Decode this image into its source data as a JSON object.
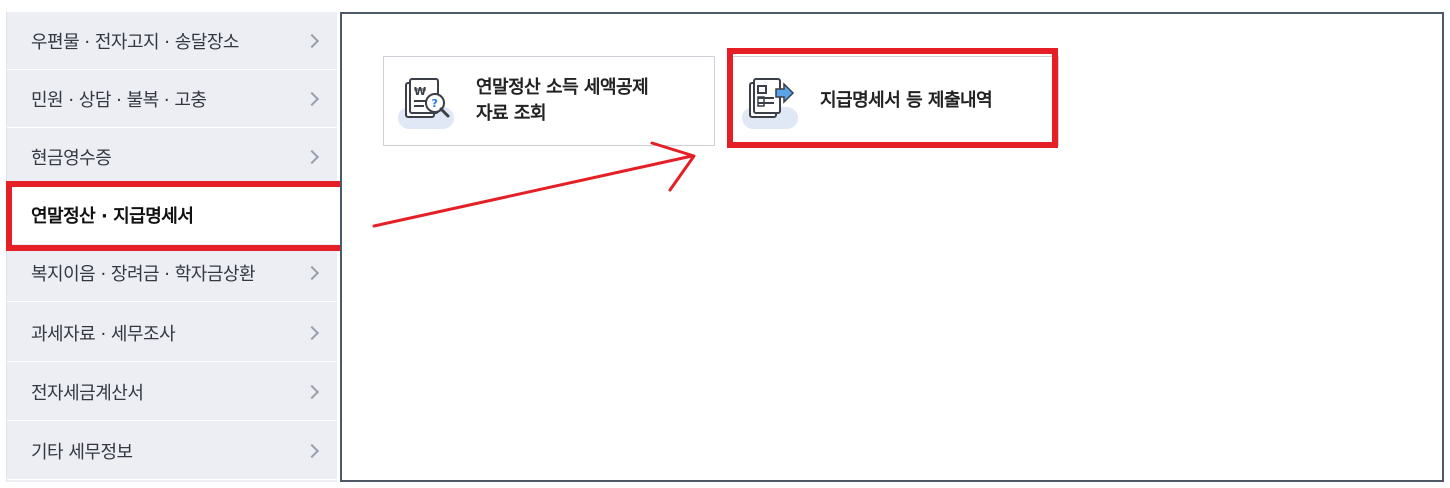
{
  "sidebar": {
    "items": [
      {
        "label": "우편물 · 전자고지 · 송달장소"
      },
      {
        "label": "민원 · 상담 · 불복 · 고충"
      },
      {
        "label": "현금영수증"
      },
      {
        "label": "연말정산 · 지급명세서",
        "active": true
      },
      {
        "label": "복지이음 · 장려금 · 학자금상환"
      },
      {
        "label": "과세자료 · 세무조사"
      },
      {
        "label": "전자세금계산서"
      },
      {
        "label": "기타 세무정보"
      }
    ]
  },
  "main": {
    "cards": [
      {
        "line1": "연말정산 소득 세액공제",
        "line2": "자료 조회",
        "icon": "document-search-icon"
      },
      {
        "line1": "지급명세서 등 제출내역",
        "icon": "document-submit-icon"
      }
    ]
  },
  "colors": {
    "highlight": "#e51f26",
    "sidebar_bg": "#eceef3",
    "panel_border": "#4f5866"
  }
}
